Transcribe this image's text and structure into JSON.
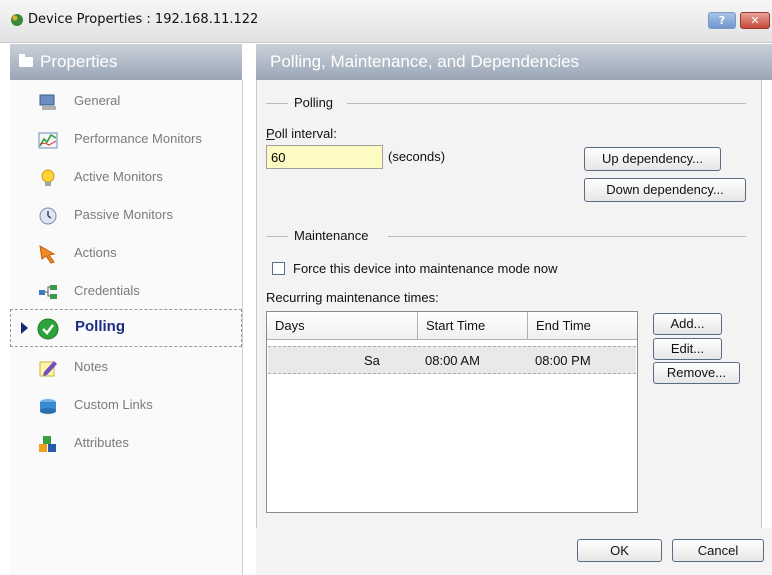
{
  "window": {
    "title": "Device Properties : 192.168.11.122",
    "help_label": "?",
    "close_label": "✕"
  },
  "sidebar": {
    "header": "Properties",
    "items": [
      {
        "label": "General",
        "icon": "computer-icon"
      },
      {
        "label": "Performance Monitors",
        "icon": "chart-icon"
      },
      {
        "label": "Active Monitors",
        "icon": "lightbulb-icon"
      },
      {
        "label": "Passive Monitors",
        "icon": "clock-icon"
      },
      {
        "label": "Actions",
        "icon": "arrow-icon"
      },
      {
        "label": "Credentials",
        "icon": "network-icon"
      },
      {
        "label": "Polling",
        "icon": "checkmark-icon",
        "selected": true
      },
      {
        "label": "Notes",
        "icon": "pencil-icon"
      },
      {
        "label": "Custom Links",
        "icon": "links-icon"
      },
      {
        "label": "Attributes",
        "icon": "blocks-icon"
      }
    ]
  },
  "main": {
    "header": "Polling, Maintenance, and Dependencies",
    "polling": {
      "group_label": "Polling",
      "interval_label": "Poll interval:",
      "interval_value": "60",
      "interval_unit": "(seconds)",
      "up_dependency_label": "Up dependency...",
      "down_dependency_label": "Down dependency..."
    },
    "maintenance": {
      "group_label": "Maintenance",
      "force_label": "Force this device into maintenance mode now",
      "force_checked": false,
      "recurring_label": "Recurring maintenance times:",
      "columns": [
        "Days",
        "Start Time",
        "End Time"
      ],
      "rows": [
        {
          "days": "Sa",
          "start": "08:00 AM",
          "end": "08:00 PM"
        }
      ],
      "add_label": "Add...",
      "edit_label": "Edit...",
      "remove_label": "Remove..."
    }
  },
  "footer": {
    "ok_label": "OK",
    "cancel_label": "Cancel"
  },
  "colors": {
    "header_gradient_top": "#c9d0da",
    "header_gradient_bottom": "#9aa6b6",
    "input_bg": "#fdfbc3",
    "selected_text": "#1d2e80"
  }
}
